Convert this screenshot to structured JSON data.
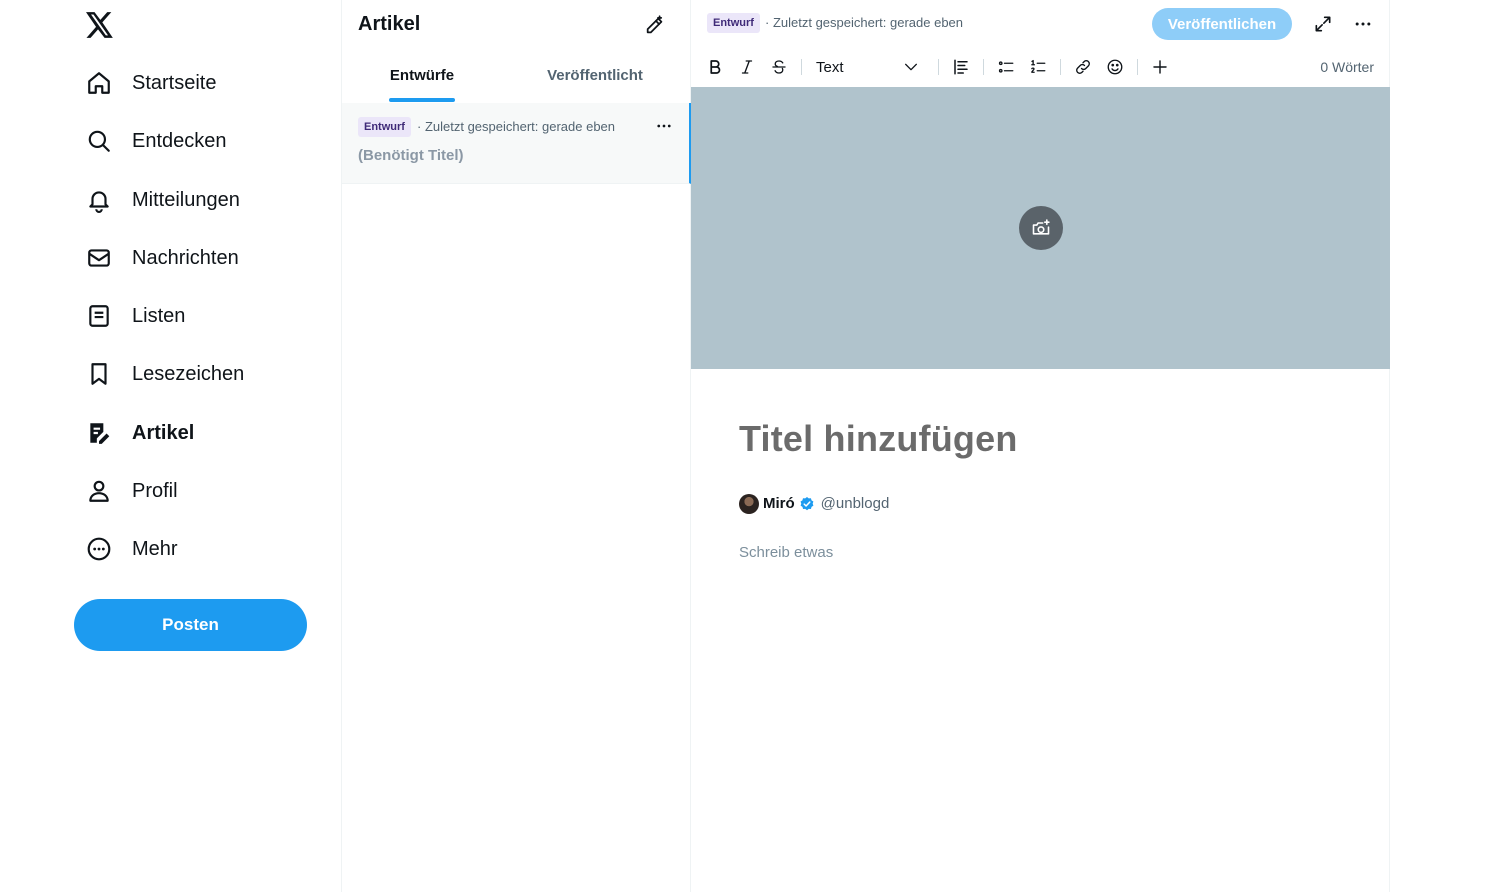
{
  "nav": {
    "items": [
      {
        "label": "Startseite",
        "icon": "home-icon"
      },
      {
        "label": "Entdecken",
        "icon": "search-icon"
      },
      {
        "label": "Mitteilungen",
        "icon": "bell-icon"
      },
      {
        "label": "Nachrichten",
        "icon": "mail-icon"
      },
      {
        "label": "Listen",
        "icon": "list-icon"
      },
      {
        "label": "Lesezeichen",
        "icon": "bookmark-icon"
      },
      {
        "label": "Artikel",
        "icon": "article-icon"
      },
      {
        "label": "Profil",
        "icon": "profile-icon"
      },
      {
        "label": "Mehr",
        "icon": "more-circle-icon"
      }
    ],
    "post_label": "Posten"
  },
  "list": {
    "title": "Artikel",
    "tabs": [
      "Entwürfe",
      "Veröffentlicht"
    ],
    "draft": {
      "badge": "Entwurf",
      "meta": "· Zuletzt gespeichert: gerade eben",
      "title": "(Benötigt Titel)"
    }
  },
  "editor": {
    "badge": "Entwurf",
    "meta": "· Zuletzt gespeichert: gerade eben",
    "publish_label": "Veröffentlichen",
    "toolbar": {
      "format_value": "Text",
      "word_count": "0 Wörter"
    },
    "title_placeholder": "Titel hinzufügen",
    "author": {
      "name": "Miró",
      "handle": "@unblogd"
    },
    "body_placeholder": "Schreib etwas"
  },
  "colors": {
    "accent": "#1d9bf0",
    "publish_disabled": "#8ecdf8",
    "cover": "#b0c3cc",
    "badge_bg": "#ebe6f9"
  }
}
